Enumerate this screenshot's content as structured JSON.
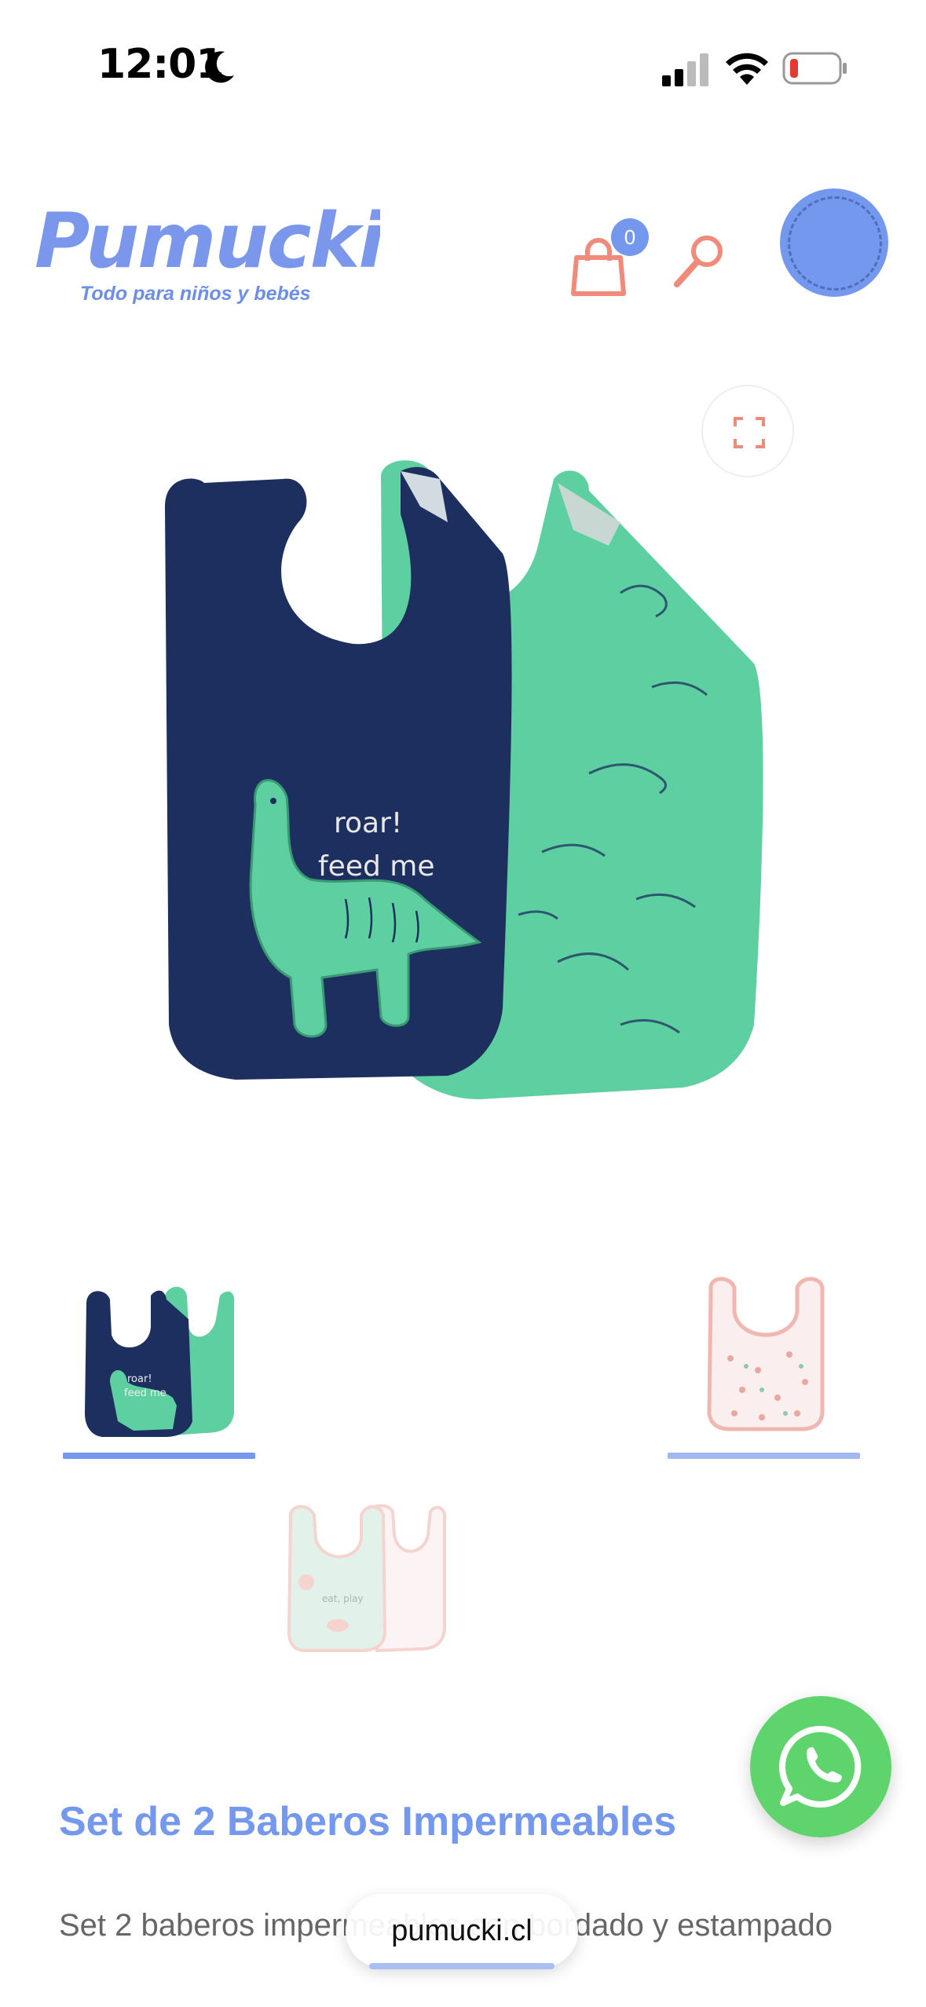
{
  "status_bar": {
    "time": "12:01"
  },
  "header": {
    "logo_text": "Pumucki",
    "logo_tagline": "Todo para niños y bebés",
    "cart_count": "0"
  },
  "gallery": {
    "thumbnails_count": 3,
    "selected_index": 0
  },
  "product": {
    "title": "Set de 2 Baberos Impermeables",
    "description": "Set 2 baberos  impermeables con bordado y estampado"
  },
  "browser": {
    "domain": "pumucki.cl"
  },
  "colors": {
    "brand_blue": "#7498ee",
    "accent_coral": "#f08a7a",
    "whatsapp_green": "#5fd46c",
    "navy_bib": "#1d2f5e",
    "mint_bib": "#5dcfa0"
  },
  "icons": {
    "cart": "shopping-bag-icon",
    "search": "search-icon",
    "fullscreen": "expand-icon",
    "whatsapp": "whatsapp-icon"
  }
}
